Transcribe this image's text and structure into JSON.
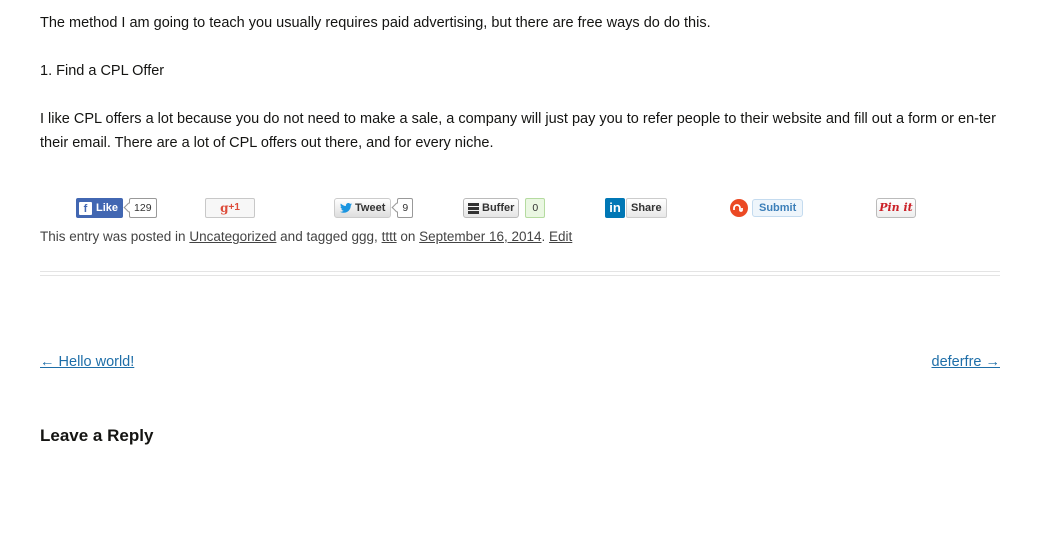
{
  "post": {
    "paragraph1": "The method I am going to teach you usually requires paid advertising, but there are free ways do do this.",
    "paragraph2": "1. Find a CPL Offer",
    "paragraph3": "I like CPL offers a lot because you do not need to make a sale, a company will just pay you to refer people to their website and fill out a form or en-ter their email. There are a lot of CPL offers out there, and for every niche."
  },
  "share": {
    "facebook": {
      "icon": "f",
      "label": "Like",
      "count": "129"
    },
    "gplus": {
      "label": "+1",
      "icon": "g"
    },
    "twitter": {
      "label": "Tweet",
      "count": "9"
    },
    "buffer": {
      "label": "Buffer",
      "count": "0"
    },
    "linkedin": {
      "icon": "in",
      "label": "Share"
    },
    "stumbleupon": {
      "label": "Submit"
    },
    "pinterest": {
      "label": "Pin it"
    }
  },
  "entry_meta": {
    "prefix": "This entry was posted in",
    "category": "Uncategorized",
    "tagged_text": "and tagged",
    "tag1": "ggg",
    "comma": ",",
    "tag2": "tttt",
    "on_text": "on",
    "date": "September 16, 2014",
    "period": ".",
    "edit": "Edit"
  },
  "nav": {
    "prev": "← Hello world!",
    "next": "deferfre →"
  },
  "reply": {
    "title": "Leave a Reply"
  },
  "colors": {
    "link": "#1e6ea8",
    "facebook": "#4267b2",
    "linkedin": "#0077b5",
    "stumbleupon": "#eb4924",
    "pinterest": "#cb2027"
  }
}
